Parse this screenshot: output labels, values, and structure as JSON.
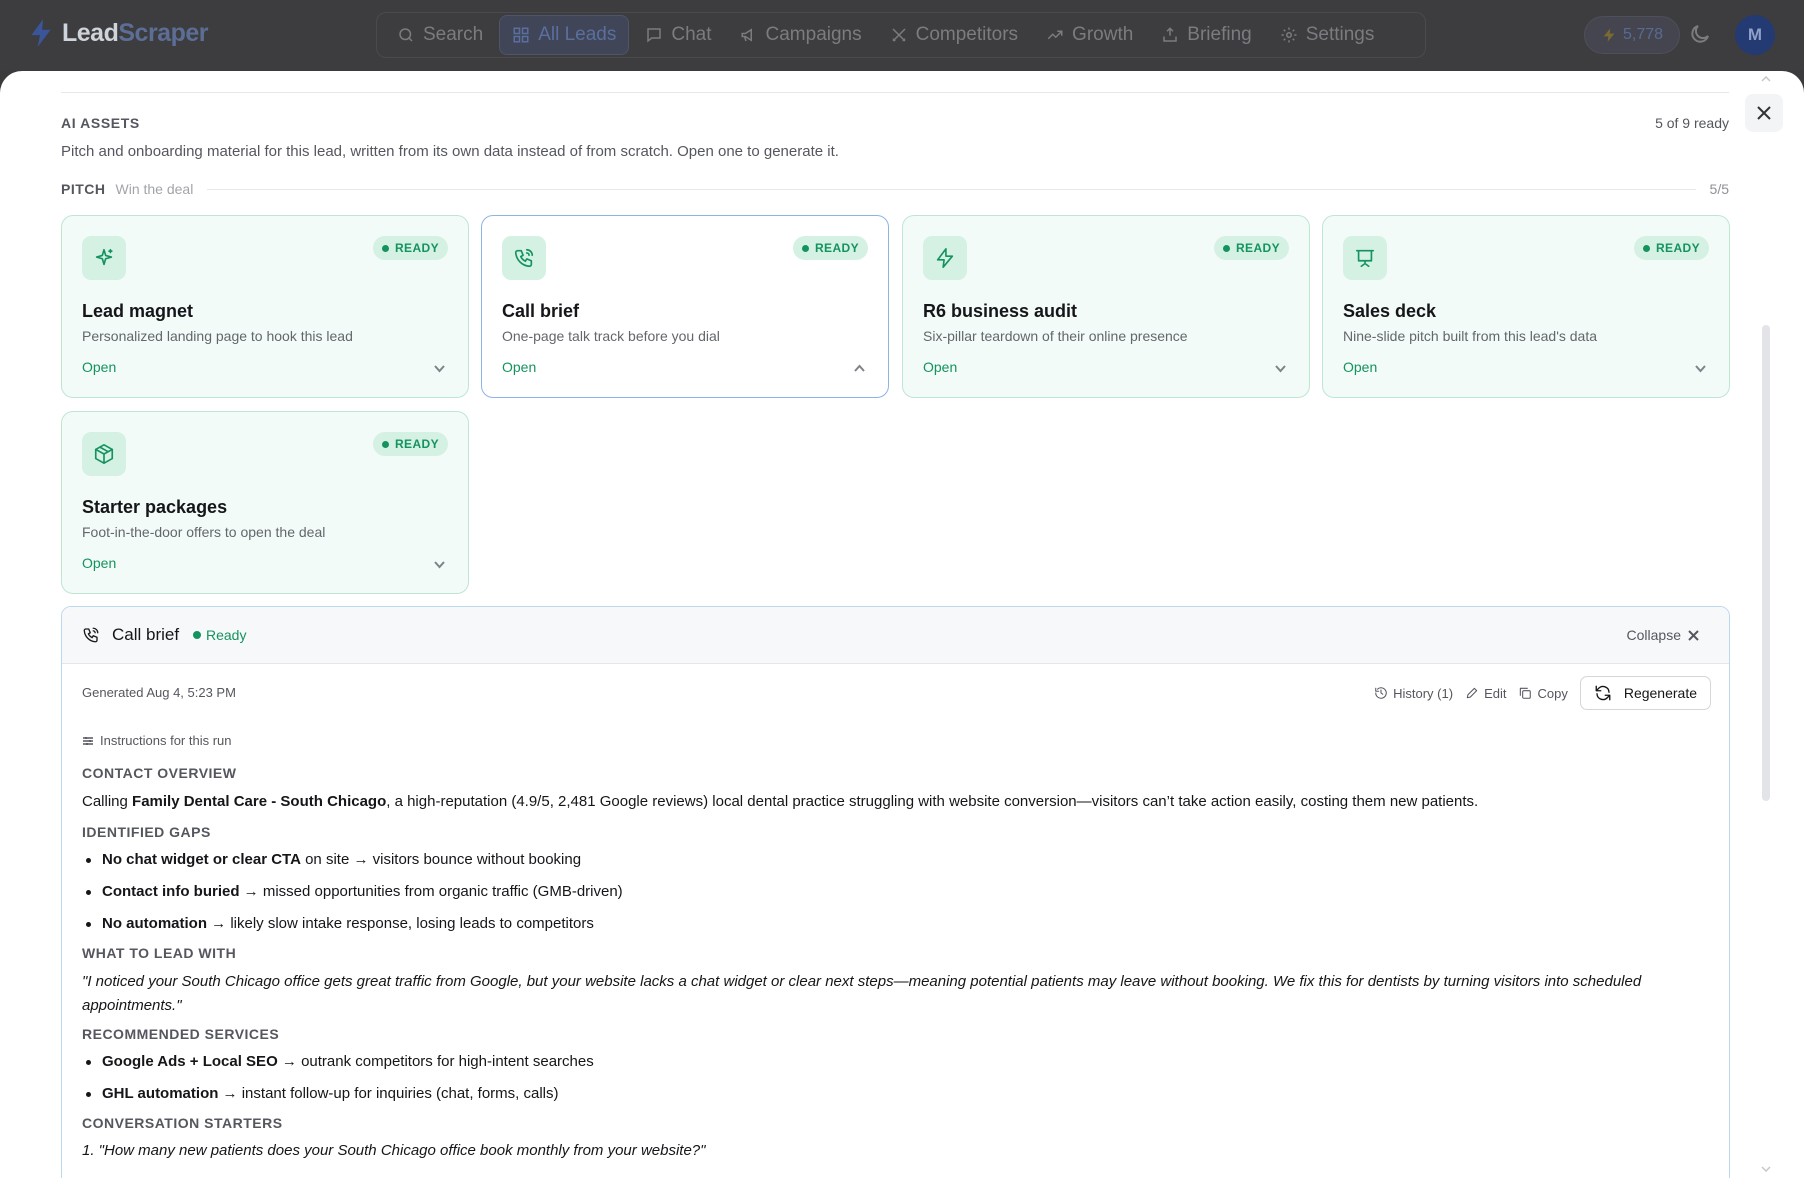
{
  "app": {
    "brand_part1": "Lead",
    "brand_part2": "Scraper",
    "nav": [
      {
        "label": "Search",
        "icon": "search-icon"
      },
      {
        "label": "All Leads",
        "icon": "grid-icon",
        "active": true
      },
      {
        "label": "Chat",
        "icon": "chat-icon"
      },
      {
        "label": "Campaigns",
        "icon": "megaphone-icon"
      },
      {
        "label": "Competitors",
        "icon": "swords-icon"
      },
      {
        "label": "Growth",
        "icon": "trend-icon"
      },
      {
        "label": "Briefing",
        "icon": "briefing-icon"
      },
      {
        "label": "Settings",
        "icon": "gear-icon"
      }
    ],
    "credits": "5,778",
    "avatar_initial": "M"
  },
  "assets": {
    "title": "AI ASSETS",
    "ready_count": "5 of 9 ready",
    "description": "Pitch and onboarding material for this lead, written from its own data instead of from scratch. Open one to generate it.",
    "group": {
      "name": "PITCH",
      "subtitle": "Win the deal",
      "count": "5/5"
    },
    "cards": [
      {
        "title": "Lead magnet",
        "desc": "Personalized landing page to hook this lead",
        "badge": "READY",
        "open": "Open",
        "icon": "sparkle-icon"
      },
      {
        "title": "Call brief",
        "desc": "One-page talk track before you dial",
        "badge": "READY",
        "open": "Open",
        "icon": "phone-icon"
      },
      {
        "title": "R6 business audit",
        "desc": "Six-pillar teardown of their online presence",
        "badge": "READY",
        "open": "Open",
        "icon": "bolt-icon"
      },
      {
        "title": "Sales deck",
        "desc": "Nine-slide pitch built from this lead's data",
        "badge": "READY",
        "open": "Open",
        "icon": "presentation-icon"
      },
      {
        "title": "Starter packages",
        "desc": "Foot-in-the-door offers to open the deal",
        "badge": "READY",
        "open": "Open",
        "icon": "package-icon"
      }
    ]
  },
  "panel": {
    "title": "Call brief",
    "status": "Ready",
    "collapse": "Collapse",
    "generated": "Generated Aug 4, 5:23 PM",
    "history": "History (1)",
    "edit": "Edit",
    "copy": "Copy",
    "regenerate": "Regenerate",
    "instructions": "Instructions for this run",
    "contact_heading": "CONTACT OVERVIEW",
    "contact_pre": "Calling ",
    "contact_bold": "Family Dental Care - South Chicago",
    "contact_post": ", a high-reputation (4.9/5, 2,481 Google reviews) local dental practice struggling with website conversion—visitors can’t take action easily, costing them new patients.",
    "gaps_heading": "IDENTIFIED GAPS",
    "gaps": [
      {
        "bold": "No chat widget or clear CTA",
        "text": " on site → visitors bounce without booking"
      },
      {
        "bold": "Contact info buried",
        "text": " → missed opportunities from organic traffic (GMB-driven)"
      },
      {
        "bold": "No automation",
        "text": " → likely slow intake response, losing leads to competitors"
      }
    ],
    "lead_heading": "WHAT TO LEAD WITH",
    "lead_quote": "\"I noticed your South Chicago office gets great traffic from Google, but your website lacks a chat widget or clear next steps—meaning potential patients may leave without booking. We fix this for dentists by turning visitors into scheduled appointments.\"",
    "services_heading": "RECOMMENDED SERVICES",
    "services": [
      {
        "bold": "Google Ads + Local SEO",
        "text": " → outrank competitors for high-intent searches"
      },
      {
        "bold": "GHL automation",
        "text": " → instant follow-up for inquiries (chat, forms, calls)"
      }
    ],
    "starters_heading": "CONVERSATION STARTERS",
    "starters": [
      "1. \"How many new patients does your South Chicago office book monthly from your website?\""
    ]
  },
  "colors": {
    "accent_green": "#15935f",
    "card_bg": "#f2fbf7",
    "selected_border": "#8fb3e6"
  }
}
